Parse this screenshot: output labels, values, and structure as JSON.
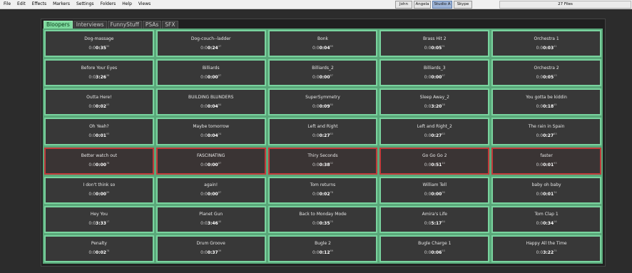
{
  "menu": [
    "File",
    "Edit",
    "Effects",
    "Markers",
    "Settings",
    "Folders",
    "Help",
    "Views"
  ],
  "users": [
    "John",
    "Angela",
    "Studio A",
    "Skype"
  ],
  "active_user": "Studio A",
  "file_count": "27 Files",
  "tabs": [
    "Bloopers",
    "Interviews",
    "FunnyStuff",
    "PSAs",
    "SFX"
  ],
  "active_tab": "Bloopers",
  "colors": {
    "active_border": "#79d39e",
    "alert_border": "#c23b3b",
    "tab_active": "#7dd99d"
  },
  "cells": [
    {
      "title": "Dog-massage",
      "lead": "0:0",
      "main": "0:35",
      "frac": "50",
      "alert": false
    },
    {
      "title": "Dog-couch--ladder",
      "lead": "0:0",
      "main": "0:24",
      "frac": "47",
      "alert": false
    },
    {
      "title": "Bonk",
      "lead": "0:0",
      "main": "0:04",
      "frac": "69",
      "alert": false
    },
    {
      "title": "Brass Hit 2",
      "lead": "0:0",
      "main": "0:05",
      "frac": "91",
      "alert": false
    },
    {
      "title": "Orchestra 1",
      "lead": "0:0",
      "main": "0:03",
      "frac": "41",
      "alert": false
    },
    {
      "title": "Before Your Eyes",
      "lead": "0:0",
      "main": "3:26",
      "frac": "36",
      "alert": false
    },
    {
      "title": "Billiards",
      "lead": "0:0",
      "main": "0:00",
      "frac": "67",
      "alert": false
    },
    {
      "title": "Billiards_2",
      "lead": "0:0",
      "main": "0:00",
      "frac": "67",
      "alert": false
    },
    {
      "title": "Billiards_3",
      "lead": "0:0",
      "main": "0:00",
      "frac": "67",
      "alert": false
    },
    {
      "title": "Orchestra 2",
      "lead": "0:0",
      "main": "0:05",
      "frac": "13",
      "alert": false
    },
    {
      "title": "Outta Here!",
      "lead": "0:0",
      "main": "0:02",
      "frac": "53",
      "alert": false
    },
    {
      "title": "BUILDING BLUNDERS",
      "lead": "0:0",
      "main": "0:04",
      "frac": "84",
      "alert": false
    },
    {
      "title": "SuperSymmetry",
      "lead": "0:0",
      "main": "0:09",
      "frac": "80",
      "alert": false
    },
    {
      "title": "Sleep Away_2",
      "lead": "0:0",
      "main": "3:20",
      "frac": "58",
      "alert": false
    },
    {
      "title": "You gotta be kiddin",
      "lead": "0:0",
      "main": "0:18",
      "frac": "45",
      "alert": false
    },
    {
      "title": "Oh Yeah?",
      "lead": "0:0",
      "main": "0:01",
      "frac": "93",
      "alert": false
    },
    {
      "title": "Maybe tomorrow",
      "lead": "0:0",
      "main": "0:04",
      "frac": "24",
      "alert": false
    },
    {
      "title": "Left and Right",
      "lead": "0:0",
      "main": "0:27",
      "frac": "83",
      "alert": false
    },
    {
      "title": "Left and Right_2",
      "lead": "0:0",
      "main": "0:27",
      "frac": "83",
      "alert": false
    },
    {
      "title": "The rain in Spain",
      "lead": "0:0",
      "main": "0:27",
      "frac": "83",
      "alert": false
    },
    {
      "title": "Better watch out",
      "lead": "0:0",
      "main": "0:00",
      "frac": "78",
      "alert": true
    },
    {
      "title": "FASCINATING",
      "lead": "0:0",
      "main": "0:00",
      "frac": "87",
      "alert": true
    },
    {
      "title": "Thiry Seconds",
      "lead": "0:0",
      "main": "0:38",
      "frac": "02",
      "alert": true
    },
    {
      "title": "Go Go Go 2",
      "lead": "0:0",
      "main": "0:51",
      "frac": "40",
      "alert": true
    },
    {
      "title": "faster",
      "lead": "0:0",
      "main": "0:01",
      "frac": "93",
      "alert": true
    },
    {
      "title": "I don't think so",
      "lead": "0:0",
      "main": "0:00",
      "frac": "99",
      "alert": false
    },
    {
      "title": "again!",
      "lead": "0:0",
      "main": "0:00",
      "frac": "87",
      "alert": false
    },
    {
      "title": "Tom returns",
      "lead": "0:0",
      "main": "0:02",
      "frac": "78",
      "alert": false
    },
    {
      "title": "William Tell",
      "lead": "0:0",
      "main": "0:00",
      "frac": "90",
      "alert": false
    },
    {
      "title": "baby oh baby",
      "lead": "0:0",
      "main": "0:01",
      "frac": "34",
      "alert": false
    },
    {
      "title": "Hey You",
      "lead": "0:0",
      "main": "3:33",
      "frac": "17",
      "alert": false
    },
    {
      "title": "Planet Gun",
      "lead": "0:0",
      "main": "3:46",
      "frac": "40",
      "alert": false
    },
    {
      "title": "Back to Monday Mode",
      "lead": "0:0",
      "main": "0:35",
      "frac": "25",
      "alert": false
    },
    {
      "title": "Amira's Life",
      "lead": "0:0",
      "main": "5:17",
      "frac": "64",
      "alert": false
    },
    {
      "title": "Tom Clap 1",
      "lead": "0:0",
      "main": "0:34",
      "frac": "16",
      "alert": false
    },
    {
      "title": "Penalty",
      "lead": "0:0",
      "main": "0:02",
      "frac": "78",
      "alert": false
    },
    {
      "title": "Drum Groove",
      "lead": "0:0",
      "main": "0:37",
      "frac": "39",
      "alert": false
    },
    {
      "title": "Bugle 2",
      "lead": "0:0",
      "main": "0:12",
      "frac": "69",
      "alert": false
    },
    {
      "title": "Bugle Charge 1",
      "lead": "0:0",
      "main": "0:06",
      "frac": "53",
      "alert": false
    },
    {
      "title": "Happy All the Time",
      "lead": "0:0",
      "main": "3:22",
      "frac": "75",
      "alert": false
    }
  ]
}
